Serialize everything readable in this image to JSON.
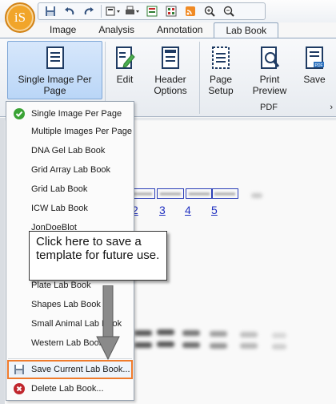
{
  "app": {
    "orb_label": "iS"
  },
  "tabs": [
    {
      "label": "Image",
      "active": false
    },
    {
      "label": "Analysis",
      "active": false
    },
    {
      "label": "Annotation",
      "active": false
    },
    {
      "label": "Lab Book",
      "active": true
    }
  ],
  "ribbon": {
    "single_image_label_1": "Single Image Per Page",
    "edit_label": "Edit",
    "header_options_line1": "Header",
    "header_options_line2": "Options",
    "page_setup_line1": "Page",
    "page_setup_line2": "Setup",
    "print_preview_line1": "Print",
    "print_preview_line2": "Preview",
    "save_label": "Save",
    "pdf_group_label": "PDF",
    "pdf_badge": "PDF"
  },
  "lanes": [
    "2",
    "3",
    "4",
    "5"
  ],
  "menu": {
    "items": [
      {
        "label": "Single Image Per Page",
        "icon": "check-icon"
      },
      {
        "label": "Multiple Images Per Page"
      },
      {
        "label": "DNA Gel Lab Book"
      },
      {
        "label": "Grid Array Lab Book"
      },
      {
        "label": "Grid Lab Book"
      },
      {
        "label": "ICW Lab Book"
      },
      {
        "label": "JonDoeBlot"
      },
      {
        "label": "Plate Lab Book"
      },
      {
        "label": "Shapes Lab Book"
      },
      {
        "label": "Small Animal Lab Book"
      },
      {
        "label": "Western Lab Book"
      }
    ],
    "save_current": "Save Current Lab Book...",
    "delete": "Delete Lab Book..."
  },
  "callout": {
    "text": "Click here to save a template for future use."
  },
  "colors": {
    "highlight": "#ef7b2c",
    "check": "#3aa335",
    "delete": "#c0262d",
    "orb": "#f1a52a"
  }
}
